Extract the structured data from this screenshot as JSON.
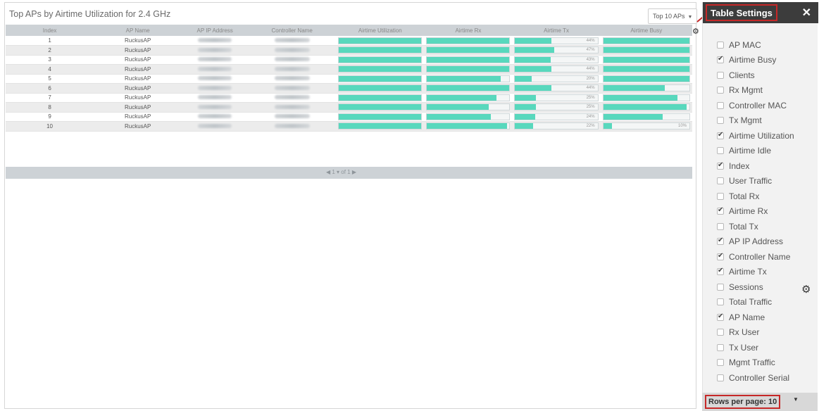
{
  "main": {
    "title": "Top APs by Airtime Utilization for 2.4 GHz",
    "top_select": "Top 10 APs",
    "columns": [
      "Index",
      "AP Name",
      "AP IP Address",
      "Controller Name",
      "Airtime Utilization",
      "Airtime Rx",
      "Airtime Tx",
      "Airtime Busy"
    ],
    "rows": [
      {
        "index": "1",
        "ap_name": "RuckusAP",
        "util": 1.0,
        "rx": 1.0,
        "tx": 0.44,
        "tx_label": "44%",
        "busy": 1.0
      },
      {
        "index": "2",
        "ap_name": "RuckusAP",
        "util": 1.0,
        "rx": 1.0,
        "tx": 0.47,
        "tx_label": "47%",
        "busy": 1.0
      },
      {
        "index": "3",
        "ap_name": "RuckusAP",
        "util": 1.0,
        "rx": 1.0,
        "tx": 0.43,
        "tx_label": "43%",
        "busy": 1.0
      },
      {
        "index": "4",
        "ap_name": "RuckusAP",
        "util": 1.0,
        "rx": 1.0,
        "tx": 0.44,
        "tx_label": "44%",
        "busy": 1.0
      },
      {
        "index": "5",
        "ap_name": "RuckusAP",
        "util": 1.0,
        "rx": 0.89,
        "tx": 0.2,
        "tx_label": "20%",
        "busy": 1.0
      },
      {
        "index": "6",
        "ap_name": "RuckusAP",
        "util": 1.0,
        "rx": 1.0,
        "tx": 0.44,
        "tx_label": "44%",
        "busy": 0.71
      },
      {
        "index": "7",
        "ap_name": "RuckusAP",
        "util": 1.0,
        "rx": 0.84,
        "tx": 0.25,
        "tx_label": "25%",
        "busy": 0.86
      },
      {
        "index": "8",
        "ap_name": "RuckusAP",
        "util": 1.0,
        "rx": 0.75,
        "tx": 0.25,
        "tx_label": "25%",
        "busy": 0.97
      },
      {
        "index": "9",
        "ap_name": "RuckusAP",
        "util": 1.0,
        "rx": 0.77,
        "tx": 0.24,
        "tx_label": "24%",
        "busy": 0.69
      },
      {
        "index": "10",
        "ap_name": "RuckusAP",
        "util": 1.0,
        "rx": 0.97,
        "tx": 0.22,
        "tx_label": "22%",
        "busy": 0.1,
        "busy_label": "10%"
      }
    ],
    "pager": "◀ 1 ▾ of 1 ▶"
  },
  "settings": {
    "title": "Table Settings",
    "close_label": "✕",
    "columns": [
      {
        "label": "AP MAC",
        "checked": false
      },
      {
        "label": "Airtime Busy",
        "checked": true
      },
      {
        "label": "Clients",
        "checked": false
      },
      {
        "label": "Rx Mgmt",
        "checked": false
      },
      {
        "label": "Controller MAC",
        "checked": false
      },
      {
        "label": "Tx Mgmt",
        "checked": false
      },
      {
        "label": "Airtime Utilization",
        "checked": true
      },
      {
        "label": "Airtime Idle",
        "checked": false
      },
      {
        "label": "Index",
        "checked": true
      },
      {
        "label": "User Traffic",
        "checked": false
      },
      {
        "label": "Total Rx",
        "checked": false
      },
      {
        "label": "Airtime Rx",
        "checked": true
      },
      {
        "label": "Total Tx",
        "checked": false
      },
      {
        "label": "AP IP Address",
        "checked": true
      },
      {
        "label": "Controller Name",
        "checked": true
      },
      {
        "label": "Airtime Tx",
        "checked": true
      },
      {
        "label": "Sessions",
        "checked": false
      },
      {
        "label": "Total Traffic",
        "checked": false
      },
      {
        "label": "AP Name",
        "checked": true
      },
      {
        "label": "Rx User",
        "checked": false
      },
      {
        "label": "Tx User",
        "checked": false
      },
      {
        "label": "Mgmt Traffic",
        "checked": false
      },
      {
        "label": "Controller Serial",
        "checked": false
      }
    ],
    "rows_per_page_label": "Rows per page:",
    "rows_per_page_value": "10"
  },
  "colors": {
    "bar_fill": "#58d8bd",
    "header_bg": "#3c3c3c",
    "highlight": "#c62828"
  },
  "icons": {
    "table_settings_gear": "gear-icon",
    "side_gear": "gear-icon"
  }
}
